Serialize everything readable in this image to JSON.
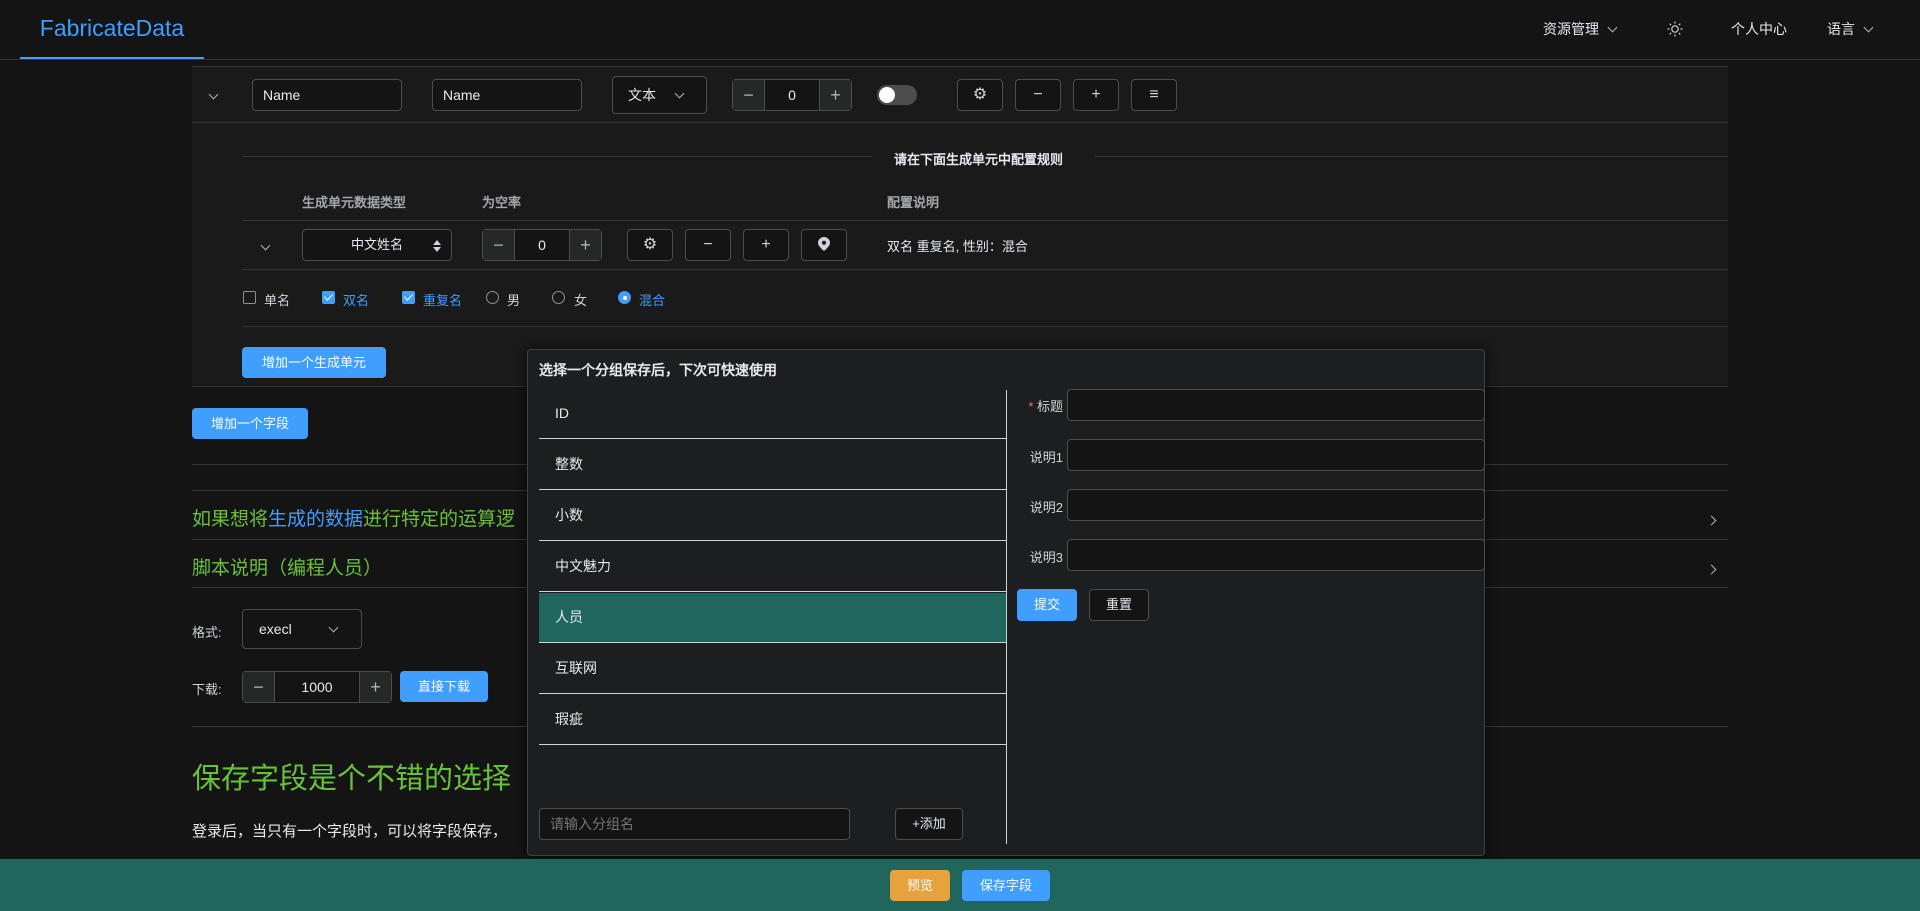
{
  "header": {
    "logo": "FabricateData",
    "resource_menu": "资源管理",
    "profile": "个人中心",
    "language": "语言"
  },
  "field_row": {
    "name_value": "Name",
    "alias_value": "Name",
    "type_select": "文本",
    "count_value": "0"
  },
  "unit_section": {
    "divider_title": "请在下面生成单元中配置规则",
    "col_type": "生成单元数据类型",
    "col_null_rate": "为空率",
    "col_config": "配置说明",
    "unit_type": "中文姓名",
    "null_rate": "0",
    "config_desc": "双名 重复名, 性别：混合",
    "options": [
      {
        "label": "单名",
        "checked": false
      },
      {
        "label": "双名",
        "checked": true
      },
      {
        "label": "重复名",
        "checked": true
      }
    ],
    "gender": [
      {
        "label": "男",
        "selected": false
      },
      {
        "label": "女",
        "selected": false
      },
      {
        "label": "混合",
        "selected": true
      }
    ],
    "add_unit": "增加一个生成单元"
  },
  "add_field": "增加一个字段",
  "collapse1": {
    "part1": "如果想将",
    "part2": "生成的数据",
    "part3": "进行特定的运算逻"
  },
  "collapse2": "脚本说明（编程人员）",
  "format": {
    "label": "格式:",
    "value": "execl"
  },
  "download": {
    "label": "下载:",
    "value": "1000",
    "button": "直接下载"
  },
  "save_heading": "保存字段是个不错的选择",
  "save_desc": "登录后，当只有一个字段时，可以将字段保存，",
  "popover": {
    "title": "选择一个分组保存后，下次可快速使用",
    "groups": [
      "ID",
      "整数",
      "小数",
      "中文魅力",
      "人员",
      "互联网",
      "瑕疵"
    ],
    "selected_group": "人员",
    "group_placeholder": "请输入分组名",
    "add_group": "+添加",
    "form": {
      "title_label": "标题",
      "desc1_label": "说明1",
      "desc2_label": "说明2",
      "desc3_label": "说明3",
      "submit": "提交",
      "reset": "重置"
    }
  },
  "footer": {
    "preview": "预览",
    "save_field": "保存字段"
  },
  "colors": {
    "primary": "#409eff",
    "success": "#67c23a",
    "warning": "#e6a23c",
    "teal": "#21665c"
  }
}
